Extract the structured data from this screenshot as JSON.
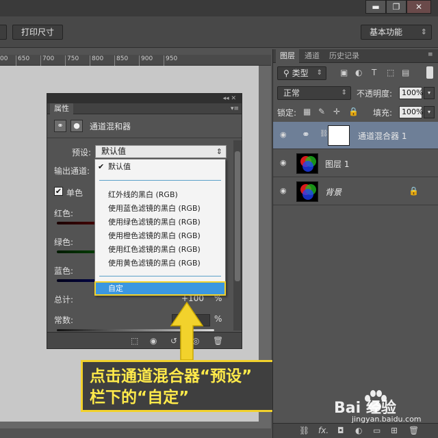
{
  "window_controls": {
    "minimize": "▬",
    "restore": "❐",
    "close": "✕"
  },
  "toolbar": {
    "print_size_label": "打印尺寸",
    "workspace": "基本功能"
  },
  "ruler": {
    "ticks": [
      "00",
      "650",
      "700",
      "750",
      "800",
      "850",
      "900",
      "950"
    ]
  },
  "properties_panel": {
    "collapse_glyph": "◂◂ ✕",
    "tab": "属性",
    "menu_glyph": "▾≡",
    "adjustment_name": "通道混和器",
    "preset_label": "预设:",
    "preset_value": "默认值",
    "output_channel_label": "输出通道:",
    "monochrome_label": "单色",
    "red_label": "红色:",
    "green_label": "绿色:",
    "blue_label": "蓝色:",
    "total_label": "总计:",
    "total_value": "+100",
    "constant_label": "常数:",
    "percent": "%"
  },
  "preset_dropdown": {
    "checked_item": "默认值",
    "items": [
      "红外线的黑白 (RGB)",
      "使用蓝色滤镜的黑白 (RGB)",
      "使用绿色滤镜的黑白 (RGB)",
      "使用橙色滤镜的黑白 (RGB)",
      "使用红色滤镜的黑白 (RGB)",
      "使用黄色滤镜的黑白 (RGB)"
    ],
    "custom_item": "自定"
  },
  "callout": {
    "line1": "点击通道混合器“预设”",
    "line2": "栏下的“自定”"
  },
  "layers_panel": {
    "tabs": [
      "图层",
      "通道",
      "历史记录"
    ],
    "filter_kind": "类型",
    "blend_mode": "正常",
    "opacity_label": "不透明度:",
    "opacity_value": "100%",
    "lock_label": "锁定:",
    "fill_label": "填充:",
    "fill_value": "100%",
    "layers": [
      {
        "name": "通道混合器 1"
      },
      {
        "name": "图层 1"
      },
      {
        "name": "背景"
      }
    ]
  },
  "watermark": {
    "brand": "Bai 经验",
    "url": "jingyan.baidu.com"
  },
  "colors": {
    "accent": "#f2d22c",
    "selection": "#3b97e0",
    "layer_active": "#6e7f97"
  }
}
